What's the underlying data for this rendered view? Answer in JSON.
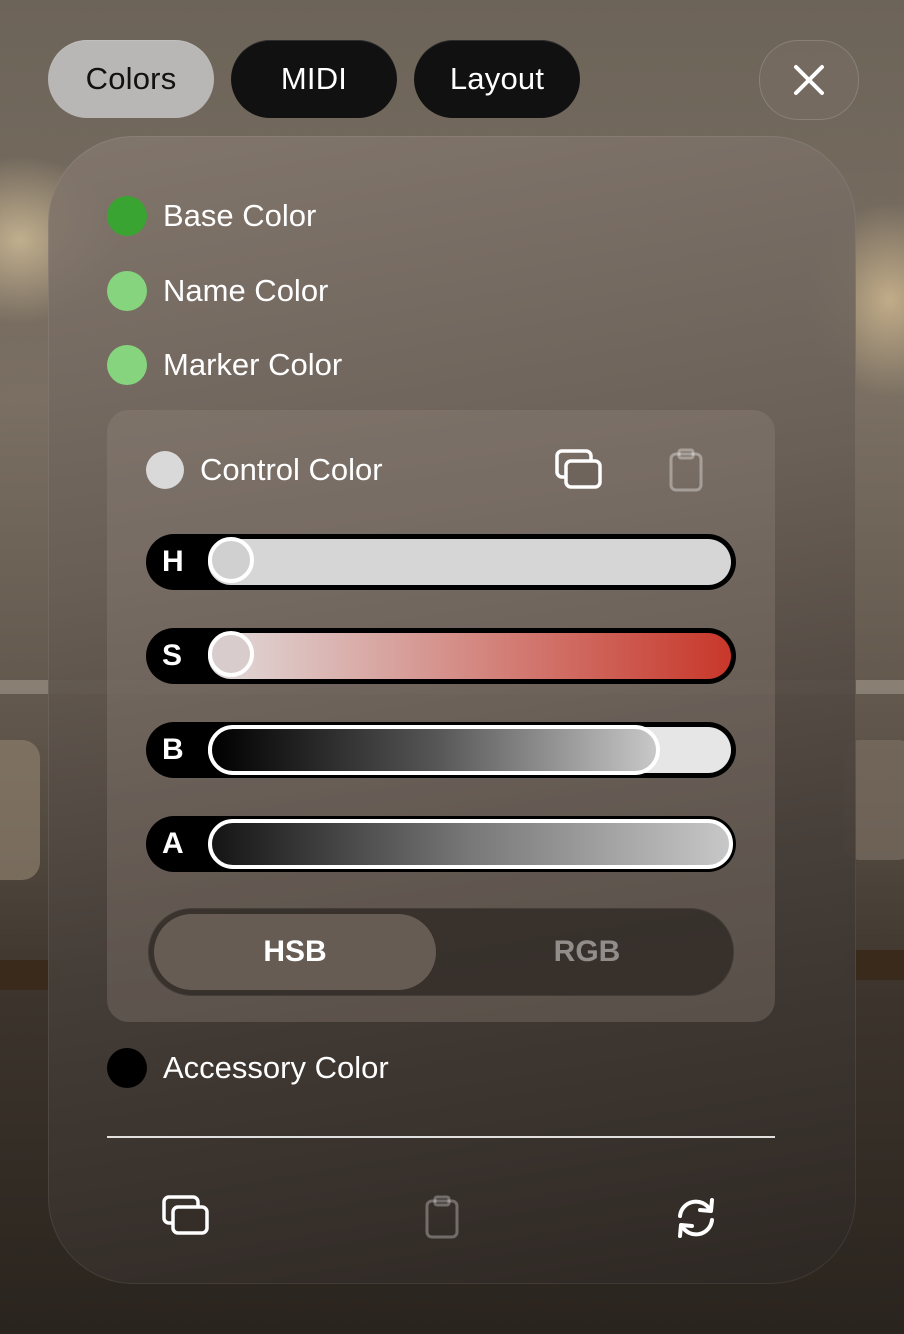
{
  "tabs": [
    {
      "label": "Colors",
      "active": true
    },
    {
      "label": "MIDI",
      "active": false
    },
    {
      "label": "Layout",
      "active": false
    }
  ],
  "close_icon": "close-icon",
  "color_rows": {
    "base": {
      "label": "Base Color",
      "color": "#3aa432"
    },
    "name": {
      "label": "Name Color",
      "color": "#86d47e"
    },
    "marker": {
      "label": "Marker Color",
      "color": "#86d47e"
    },
    "control": {
      "label": "Control Color",
      "color": "#d9d9d9"
    },
    "accessory": {
      "label": "Accessory Color",
      "color": "#000000"
    }
  },
  "editor": {
    "copy_icon": "copy-icon",
    "paste_icon": "clipboard-icon",
    "sliders": [
      {
        "letter": "H",
        "value": 0.0
      },
      {
        "letter": "S",
        "value": 0.0
      },
      {
        "letter": "B",
        "value": 0.86
      },
      {
        "letter": "A",
        "value": 1.0
      }
    ],
    "mode": {
      "options": [
        "HSB",
        "RGB"
      ],
      "selected": "HSB"
    }
  },
  "footer": {
    "copy_icon": "copy-icon",
    "paste_icon": "clipboard-icon",
    "reset_icon": "refresh-icon"
  },
  "colors": {
    "saturation_end": "#c8372a",
    "tab_active_bg": "#b9b6b6",
    "tab_bg": "#111111"
  }
}
